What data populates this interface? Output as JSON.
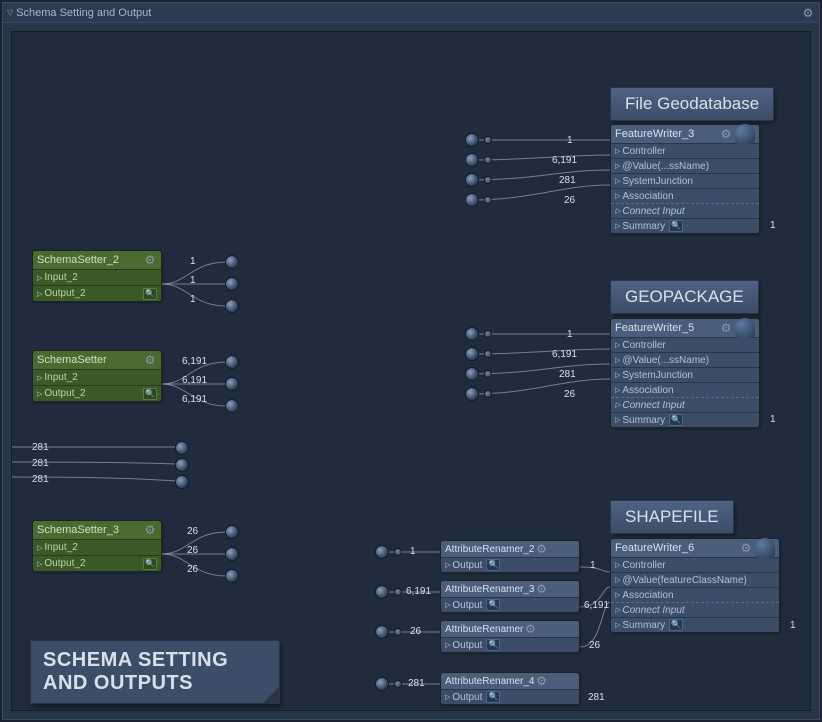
{
  "window": {
    "title": "Schema Setting and Output"
  },
  "sticky": {
    "line1": "SCHEMA SETTING",
    "line2": "AND OUTPUTS"
  },
  "sections": {
    "filegdb": "File Geodatabase",
    "gpkg": "GEOPACKAGE",
    "shp": "SHAPEFILE"
  },
  "schema_setters": [
    {
      "name": "SchemaSetter_2",
      "input": "Input_2",
      "output": "Output_2",
      "counts": [
        "1",
        "1",
        "1"
      ]
    },
    {
      "name": "SchemaSetter",
      "input": "Input_2",
      "output": "Output_2",
      "counts": [
        "6,191",
        "6,191",
        "6,191"
      ]
    },
    {
      "name": "SchemaSetter_3",
      "input": "Input_2",
      "output": "Output_2",
      "counts": [
        "26",
        "26",
        "26"
      ]
    }
  ],
  "mid_counts": [
    "281",
    "281",
    "281"
  ],
  "writers": {
    "fw3": {
      "name": "FeatureWriter_3",
      "rows": [
        "Controller",
        "@Value(...ssName)",
        "SystemJunction",
        "Association",
        "Connect Input",
        "Summary"
      ],
      "in_counts": [
        "1",
        "6,191",
        "281",
        "26"
      ],
      "out_count": "1"
    },
    "fw5": {
      "name": "FeatureWriter_5",
      "rows": [
        "Controller",
        "@Value(...ssName)",
        "SystemJunction",
        "Association",
        "Connect Input",
        "Summary"
      ],
      "in_counts": [
        "1",
        "6,191",
        "281",
        "26"
      ],
      "out_count": "1"
    },
    "fw6": {
      "name": "FeatureWriter_6",
      "rows": [
        "Controller",
        "@Value(featureClassName)",
        "Association",
        "Connect Input",
        "Summary"
      ],
      "out_count": "1"
    }
  },
  "renamers": [
    {
      "name": "AttributeRenamer_2",
      "output": "Output",
      "in": "1",
      "out": "1"
    },
    {
      "name": "AttributeRenamer_3",
      "output": "Output",
      "in": "6,191",
      "out": "6,191"
    },
    {
      "name": "AttributeRenamer",
      "output": "Output",
      "in": "26",
      "out": "26"
    },
    {
      "name": "AttributeRenamer_4",
      "output": "Output",
      "in": "281",
      "out": "281"
    }
  ]
}
